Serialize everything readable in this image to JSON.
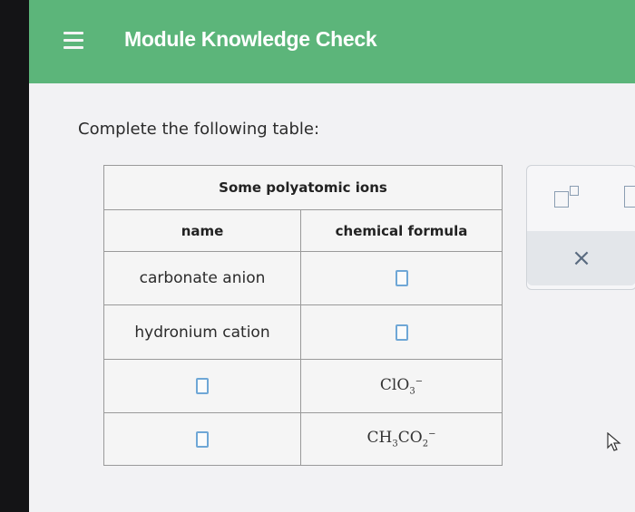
{
  "header": {
    "title": "Module Knowledge Check",
    "accent_color": "#5cb57a",
    "menu_icon": "hamburger-menu-icon"
  },
  "main": {
    "instruction": "Complete the following table:"
  },
  "table": {
    "title": "Some polyatomic ions",
    "columns": [
      "name",
      "chemical formula"
    ],
    "rows": [
      {
        "name": "carbonate anion",
        "formula": ""
      },
      {
        "name": "hydronium cation",
        "formula": ""
      },
      {
        "name": "",
        "formula": "ClO3-"
      },
      {
        "name": "",
        "formula": "CH3CO2-"
      }
    ]
  },
  "formula_display": {
    "row3": {
      "main1": "ClO",
      "sub1": "3",
      "sup1": "−"
    },
    "row4": {
      "main1": "CH",
      "sub1": "3",
      "main2": "CO",
      "sub2": "2",
      "sup2": "−"
    }
  },
  "tool_panel": {
    "icons": [
      "superscript-icon",
      "subscript-icon",
      "close-icon"
    ],
    "close_glyph": "×"
  }
}
